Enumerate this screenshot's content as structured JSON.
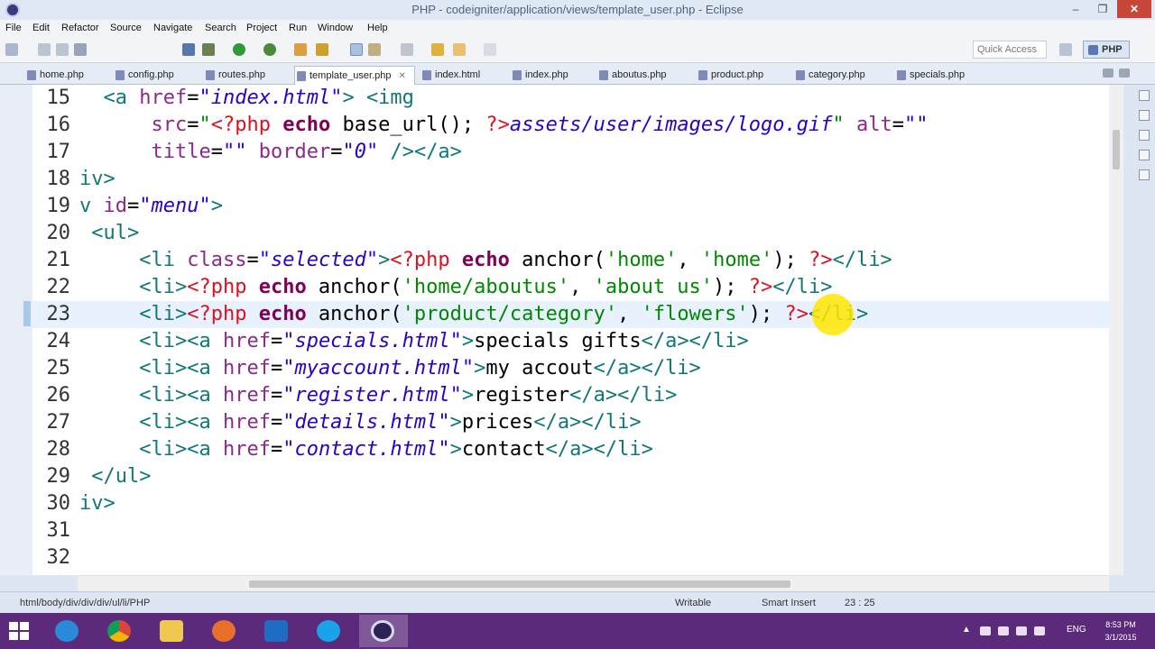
{
  "window": {
    "title": "PHP - codeigniter/application/views/template_user.php - Eclipse",
    "minimize": "‒",
    "maximize": "❐",
    "close": "✕"
  },
  "menu": [
    "File",
    "Edit",
    "Refactor",
    "Source",
    "Navigate",
    "Search",
    "Project",
    "Run",
    "Window",
    "Help"
  ],
  "toolbar": {
    "quick_access_placeholder": "Quick Access",
    "perspective": "PHP"
  },
  "tabs": [
    {
      "label": "home.php",
      "active": false
    },
    {
      "label": "config.php",
      "active": false
    },
    {
      "label": "routes.php",
      "active": false
    },
    {
      "label": "template_user.php",
      "active": true,
      "close": "✕"
    },
    {
      "label": "index.html",
      "active": false
    },
    {
      "label": "index.php",
      "active": false
    },
    {
      "label": "aboutus.php",
      "active": false
    },
    {
      "label": "product.php",
      "active": false
    },
    {
      "label": "category.php",
      "active": false
    },
    {
      "label": "specials.php",
      "active": false
    }
  ],
  "editor": {
    "current_line": "23",
    "lines": [
      {
        "n": "15",
        "tokens": [
          [
            "t",
            "  "
          ],
          [
            "tag",
            "<a"
          ],
          [
            "t",
            " "
          ],
          [
            "attr",
            "href"
          ],
          [
            "eq",
            "="
          ],
          [
            "str",
            "\"index.html\""
          ],
          [
            "tag",
            ">"
          ],
          [
            "t",
            " "
          ],
          [
            "tag",
            "<img"
          ]
        ]
      },
      {
        "n": "16",
        "tokens": [
          [
            "t",
            "      "
          ],
          [
            "attr",
            "src"
          ],
          [
            "eq",
            "="
          ],
          [
            "str2",
            "\""
          ],
          [
            "php",
            "<?php"
          ],
          [
            "t",
            " "
          ],
          [
            "kw",
            "echo"
          ],
          [
            "fn",
            " base_url(); "
          ],
          [
            "php",
            "?>"
          ],
          [
            "str",
            "assets/user/images/logo.gif"
          ],
          [
            "str2",
            "\""
          ],
          [
            "t",
            " "
          ],
          [
            "attr",
            "alt"
          ],
          [
            "eq",
            "="
          ],
          [
            "str",
            "\"\""
          ]
        ]
      },
      {
        "n": "17",
        "tokens": [
          [
            "t",
            "      "
          ],
          [
            "attr",
            "title"
          ],
          [
            "eq",
            "="
          ],
          [
            "str",
            "\"\""
          ],
          [
            "t",
            " "
          ],
          [
            "attr",
            "border"
          ],
          [
            "eq",
            "="
          ],
          [
            "str",
            "\"0\""
          ],
          [
            "t",
            " "
          ],
          [
            "tag",
            "/></a>"
          ]
        ]
      },
      {
        "n": "18",
        "tokens": [
          [
            "tag",
            "iv>"
          ]
        ]
      },
      {
        "n": "19",
        "tokens": [
          [
            "tag",
            "v"
          ],
          [
            "t",
            " "
          ],
          [
            "attr",
            "id"
          ],
          [
            "eq",
            "="
          ],
          [
            "str",
            "\"menu\""
          ],
          [
            "tag",
            ">"
          ]
        ]
      },
      {
        "n": "20",
        "tokens": [
          [
            "t",
            " "
          ],
          [
            "tag",
            "<ul>"
          ]
        ]
      },
      {
        "n": "21",
        "tokens": [
          [
            "t",
            "     "
          ],
          [
            "tag",
            "<li"
          ],
          [
            "t",
            " "
          ],
          [
            "attr",
            "class"
          ],
          [
            "eq",
            "="
          ],
          [
            "str",
            "\"selected\""
          ],
          [
            "tag",
            ">"
          ],
          [
            "php",
            "<?php"
          ],
          [
            "t",
            " "
          ],
          [
            "kw",
            "echo"
          ],
          [
            "fn",
            " anchor("
          ],
          [
            "str2",
            "'home'"
          ],
          [
            "fn",
            ", "
          ],
          [
            "str2",
            "'home'"
          ],
          [
            "fn",
            "); "
          ],
          [
            "php",
            "?>"
          ],
          [
            "tag",
            "</li>"
          ]
        ]
      },
      {
        "n": "22",
        "tokens": [
          [
            "t",
            "     "
          ],
          [
            "tag",
            "<li>"
          ],
          [
            "php",
            "<?php"
          ],
          [
            "t",
            " "
          ],
          [
            "kw",
            "echo"
          ],
          [
            "fn",
            " anchor("
          ],
          [
            "str2",
            "'home/aboutus'"
          ],
          [
            "fn",
            ", "
          ],
          [
            "str2",
            "'about us'"
          ],
          [
            "fn",
            "); "
          ],
          [
            "php",
            "?>"
          ],
          [
            "tag",
            "</li>"
          ]
        ]
      },
      {
        "n": "23",
        "tokens": [
          [
            "t",
            "     "
          ],
          [
            "tag",
            "<li>"
          ],
          [
            "php",
            "<?php"
          ],
          [
            "t",
            " "
          ],
          [
            "kw",
            "echo"
          ],
          [
            "fn",
            " anchor("
          ],
          [
            "str2",
            "'product/category'"
          ],
          [
            "fn",
            ", "
          ],
          [
            "str2",
            "'flowers'"
          ],
          [
            "fn",
            "); "
          ],
          [
            "php",
            "?>"
          ],
          [
            "tag",
            "</li>"
          ]
        ]
      },
      {
        "n": "24",
        "tokens": [
          [
            "t",
            "     "
          ],
          [
            "tag",
            "<li><a"
          ],
          [
            "t",
            " "
          ],
          [
            "attr",
            "href"
          ],
          [
            "eq",
            "="
          ],
          [
            "str",
            "\"specials.html\""
          ],
          [
            "tag",
            ">"
          ],
          [
            "fn",
            "specials gifts"
          ],
          [
            "tag",
            "</a></li>"
          ]
        ]
      },
      {
        "n": "25",
        "tokens": [
          [
            "t",
            "     "
          ],
          [
            "tag",
            "<li><a"
          ],
          [
            "t",
            " "
          ],
          [
            "attr",
            "href"
          ],
          [
            "eq",
            "="
          ],
          [
            "str",
            "\"myaccount.html\""
          ],
          [
            "tag",
            ">"
          ],
          [
            "fn",
            "my accout"
          ],
          [
            "tag",
            "</a></li>"
          ]
        ]
      },
      {
        "n": "26",
        "tokens": [
          [
            "t",
            "     "
          ],
          [
            "tag",
            "<li><a"
          ],
          [
            "t",
            " "
          ],
          [
            "attr",
            "href"
          ],
          [
            "eq",
            "="
          ],
          [
            "str",
            "\"register.html\""
          ],
          [
            "tag",
            ">"
          ],
          [
            "fn",
            "register"
          ],
          [
            "tag",
            "</a></li>"
          ]
        ]
      },
      {
        "n": "27",
        "tokens": [
          [
            "t",
            "     "
          ],
          [
            "tag",
            "<li><a"
          ],
          [
            "t",
            " "
          ],
          [
            "attr",
            "href"
          ],
          [
            "eq",
            "="
          ],
          [
            "str",
            "\"details.html\""
          ],
          [
            "tag",
            ">"
          ],
          [
            "fn",
            "prices"
          ],
          [
            "tag",
            "</a></li>"
          ]
        ]
      },
      {
        "n": "28",
        "tokens": [
          [
            "t",
            "     "
          ],
          [
            "tag",
            "<li><a"
          ],
          [
            "t",
            " "
          ],
          [
            "attr",
            "href"
          ],
          [
            "eq",
            "="
          ],
          [
            "str",
            "\"contact.html\""
          ],
          [
            "tag",
            ">"
          ],
          [
            "fn",
            "contact"
          ],
          [
            "tag",
            "</a></li>"
          ]
        ]
      },
      {
        "n": "29",
        "tokens": [
          [
            "t",
            " "
          ],
          [
            "tag",
            "</ul>"
          ]
        ]
      },
      {
        "n": "30",
        "tokens": [
          [
            "tag",
            "iv>"
          ]
        ]
      },
      {
        "n": "31",
        "tokens": []
      },
      {
        "n": "32",
        "tokens": []
      }
    ]
  },
  "status": {
    "path": "html/body/div/div/div/ul/li/PHP",
    "mode": "Writable",
    "insert": "Smart Insert",
    "position": "23 : 25"
  },
  "taskbar": {
    "lang": "ENG",
    "time": "8:53 PM",
    "date": "3/1/2015",
    "apps": [
      "internet-explorer-icon",
      "chrome-icon",
      "file-explorer-icon",
      "firefox-icon",
      "outlook-icon",
      "skype-icon",
      "eclipse-icon"
    ]
  },
  "colors": {
    "tag": "#117777",
    "attr": "#8a2a8a",
    "string": "#2a00cc",
    "php_delim": "#dd1122",
    "keyword": "#7f0055",
    "taskbar": "#5b2a7a"
  }
}
